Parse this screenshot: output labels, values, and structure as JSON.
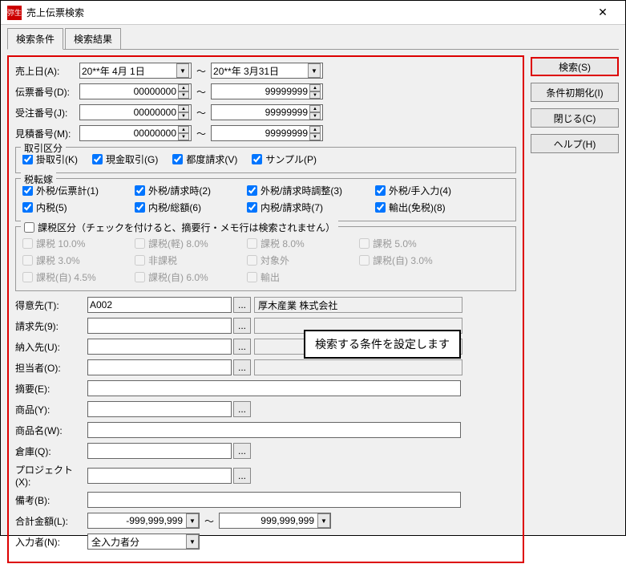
{
  "window": {
    "title": "売上伝票検索",
    "close": "✕"
  },
  "tabs": {
    "search_cond": "検索条件",
    "search_result": "検索結果"
  },
  "buttons": {
    "search": "検索(S)",
    "reset": "条件初期化(I)",
    "close": "閉じる(C)",
    "help": "ヘルプ(H)"
  },
  "labels": {
    "date": "売上日(A):",
    "slip": "伝票番号(D):",
    "order": "受注番号(J):",
    "quote": "見積番号(M):",
    "tori": "取引区分",
    "zei": "税転嫁",
    "kazei": "課税区分（チェックを付けると、摘要行・メモ行は検索されません）",
    "tokuisaki": "得意先(T):",
    "seikyu": "請求先(9):",
    "nounyu": "納入先(U):",
    "tantou": "担当者(O):",
    "tekiyo": "摘要(E):",
    "shohin": "商品(Y):",
    "shohinmei": "商品名(W):",
    "souko": "倉庫(Q):",
    "project": "プロジェクト(X):",
    "bikou": "備考(B):",
    "goukei": "合計金額(L):",
    "nyuryoku": "入力者(N):",
    "tilde": "～"
  },
  "values": {
    "date_from": "20**年 4月 1日",
    "date_to": "20**年 3月31日",
    "num_from": "00000000",
    "num_to": "99999999",
    "tokuisaki_code": "A002",
    "tokuisaki_name": "厚木産業 株式会社",
    "amount_from": "-999,999,999",
    "amount_to": "999,999,999",
    "nyuryoku": "全入力者分"
  },
  "tori": {
    "a": "掛取引(K)",
    "b": "現金取引(G)",
    "c": "都度請求(V)",
    "d": "サンプル(P)"
  },
  "zei": {
    "a": "外税/伝票計(1)",
    "b": "外税/請求時(2)",
    "c": "外税/請求時調整(3)",
    "d": "外税/手入力(4)",
    "e": "内税(5)",
    "f": "内税/総額(6)",
    "g": "内税/請求時(7)",
    "h": "輸出(免税)(8)"
  },
  "kazei": {
    "a": "課税 10.0%",
    "b": "課税(軽) 8.0%",
    "c": "課税 8.0%",
    "d": "課税 5.0%",
    "e": "課税 3.0%",
    "f": "非課税",
    "g": "対象外",
    "h": "課税(自) 3.0%",
    "i": "課税(自) 4.5%",
    "j": "課税(自) 6.0%",
    "k": "輸出"
  },
  "callout": "検索する条件を設定します"
}
